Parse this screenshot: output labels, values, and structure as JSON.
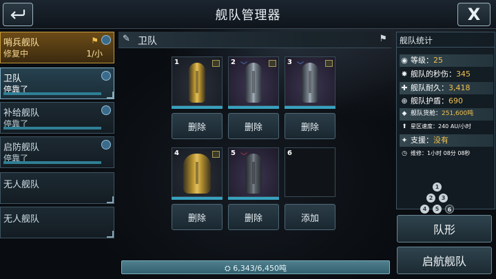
{
  "header": {
    "title": "舰队管理器",
    "back_icon": "back-arrow-icon",
    "close_label": "X"
  },
  "fleets": [
    {
      "name": "哨兵舰队",
      "status": "修复中",
      "count": "1/小",
      "state": "active"
    },
    {
      "name": "卫队",
      "status": "停靠了",
      "state": "selected"
    },
    {
      "name": "补给舰队",
      "status": "停靠了"
    },
    {
      "name": "启防舰队",
      "status": "停靠了"
    },
    {
      "name": "无人舰队"
    },
    {
      "name": "无人舰队"
    }
  ],
  "group": {
    "name": "卫队"
  },
  "slots": [
    {
      "number": "1",
      "ship": "gold-cruiser",
      "button": "删除"
    },
    {
      "number": "2",
      "ship": "gray-frigate",
      "button": "删除"
    },
    {
      "number": "3",
      "ship": "gray-frigate",
      "button": "删除"
    },
    {
      "number": "4",
      "ship": "gold-battleship",
      "button": "删除"
    },
    {
      "number": "5",
      "ship": "dark-destroyer",
      "button": "删除"
    },
    {
      "number": "6",
      "ship": "",
      "button": "添加"
    }
  ],
  "capacity": {
    "text": "6,343/6,450吨"
  },
  "stats": {
    "title": "舰队统计",
    "rows": [
      {
        "label": "等级：",
        "value": "25",
        "icon": "level-icon"
      },
      {
        "label": "舰队的秒伤：",
        "value": "345",
        "icon": "dps-icon"
      },
      {
        "label": "舰队耐久：",
        "value": "3,418",
        "icon": "hull-icon"
      },
      {
        "label": "舰队护盾：",
        "value": "690",
        "icon": "shield-icon"
      },
      {
        "label": "舰队货舱：",
        "value": "251,600吨",
        "icon": "cargo-icon"
      },
      {
        "label": "星区速度：",
        "value": "240 AU/小时",
        "icon": "speed-icon"
      },
      {
        "label": "支援：",
        "value": "没有",
        "icon": "support-icon"
      },
      {
        "label": "维修：",
        "value": "1小时 08分 08秒",
        "icon": "clock-icon"
      }
    ],
    "formation": [
      "1",
      "2",
      "3",
      "4",
      "5",
      "6"
    ]
  },
  "buttons": {
    "formation": "队形",
    "launch": "启航舰队"
  },
  "colors": {
    "accent": "#f2c14e",
    "active_fleet": "#6c4c17",
    "hp_bar": "#37a2c0"
  }
}
